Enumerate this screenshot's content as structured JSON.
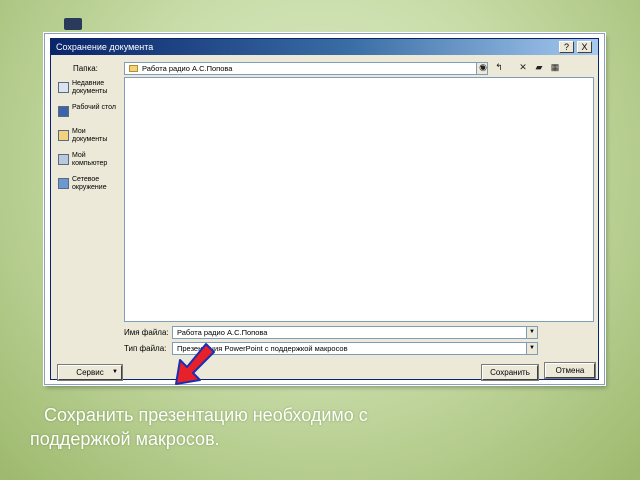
{
  "dialog": {
    "title": "Сохранение документа",
    "title_buttons": [
      "?",
      "X"
    ],
    "folder_label": "Папка:",
    "folder_value": "Работа радио А.С.Попова",
    "toolbar_icons": [
      "back-icon",
      "up-folder-icon",
      "delete-icon",
      "new-folder-icon",
      "views-icon"
    ],
    "places": [
      {
        "label": "Недавние документы",
        "icon": "recent-documents-icon"
      },
      {
        "label": "Рабочий стол",
        "icon": "desktop-icon"
      },
      {
        "label": "Мои документы",
        "icon": "my-documents-icon"
      },
      {
        "label": "Мой компьютер",
        "icon": "my-computer-icon"
      },
      {
        "label": "Сетевое окружение",
        "icon": "network-icon"
      }
    ],
    "filename_label": "Имя файла:",
    "filename_value": "Работа радио А.С.Попова",
    "filetype_label": "Тип файла:",
    "filetype_value": "Презентация PowerPoint с поддержкой макросов",
    "tools_button": "Сервис",
    "save_button": "Сохранить",
    "cancel_button": "Отмена"
  },
  "caption": {
    "line1": "Сохранить презентацию необходимо с",
    "line2": "поддержкой макросов."
  },
  "colors": {
    "arrow_fill": "#e8202a",
    "arrow_outline": "#1a2fb0",
    "titlebar": "#0a246a"
  }
}
